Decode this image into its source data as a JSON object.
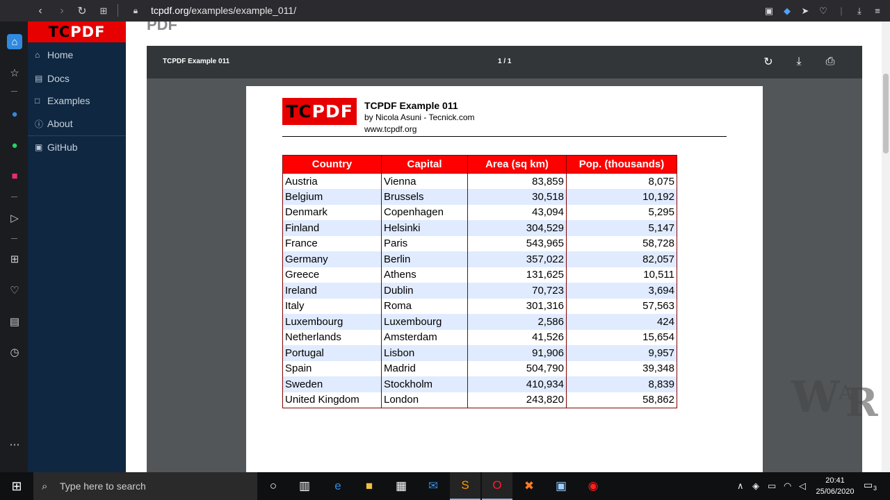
{
  "browser": {
    "url_host": "tcpdf.org",
    "url_path": "/examples/example_011/",
    "nav_icons": [
      "back-icon",
      "forward-icon",
      "reload-icon",
      "tabs-grid-icon",
      "lock-icon"
    ],
    "right_icons": [
      "camera-icon",
      "shield-icon",
      "send-icon",
      "heart-icon",
      "menu-icon",
      "download-icon",
      "more-icon"
    ]
  },
  "opera_sidebar": {
    "icons": [
      "home-icon",
      "star-icon",
      "messenger-icon",
      "whatsapp-icon",
      "instagram-icon",
      "player-icon",
      "apps-icon",
      "heart-icon",
      "news-icon",
      "history-icon",
      "more-icon"
    ]
  },
  "site": {
    "logo": "TCPDF",
    "nav": [
      {
        "label": "Home",
        "icon": "home-icon"
      },
      {
        "label": "Docs",
        "icon": "doc-icon"
      },
      {
        "label": "Examples",
        "icon": "file-icon"
      },
      {
        "label": "About",
        "icon": "info-icon"
      },
      {
        "label": "GitHub",
        "icon": "github-icon"
      }
    ],
    "page_heading": "PDF"
  },
  "viewer": {
    "title": "TCPDF Example 011",
    "pages": "1 / 1",
    "buttons": [
      "rotate-icon",
      "download-icon",
      "print-icon"
    ]
  },
  "document": {
    "logo": "TCPDF",
    "title": "TCPDF Example 011",
    "byline": "by Nicola Asuni - Tecnick.com",
    "website": "www.tcpdf.org",
    "table": {
      "headers": [
        "Country",
        "Capital",
        "Area (sq km)",
        "Pop. (thousands)"
      ],
      "rows": [
        [
          "Austria",
          "Vienna",
          "83,859",
          "8,075"
        ],
        [
          "Belgium",
          "Brussels",
          "30,518",
          "10,192"
        ],
        [
          "Denmark",
          "Copenhagen",
          "43,094",
          "5,295"
        ],
        [
          "Finland",
          "Helsinki",
          "304,529",
          "5,147"
        ],
        [
          "France",
          "Paris",
          "543,965",
          "58,728"
        ],
        [
          "Germany",
          "Berlin",
          "357,022",
          "82,057"
        ],
        [
          "Greece",
          "Athens",
          "131,625",
          "10,511"
        ],
        [
          "Ireland",
          "Dublin",
          "70,723",
          "3,694"
        ],
        [
          "Italy",
          "Roma",
          "301,316",
          "57,563"
        ],
        [
          "Luxembourg",
          "Luxembourg",
          "2,586",
          "424"
        ],
        [
          "Netherlands",
          "Amsterdam",
          "41,526",
          "15,654"
        ],
        [
          "Portugal",
          "Lisbon",
          "91,906",
          "9,957"
        ],
        [
          "Spain",
          "Madrid",
          "504,790",
          "39,348"
        ],
        [
          "Sweden",
          "Stockholm",
          "410,934",
          "8,839"
        ],
        [
          "United Kingdom",
          "London",
          "243,820",
          "58,862"
        ]
      ]
    }
  },
  "watermark": {
    "text": "WAR"
  },
  "taskbar": {
    "search_placeholder": "Type here to search",
    "apps": [
      "cortana-icon",
      "task-view-icon",
      "edge-icon",
      "file-explorer-icon",
      "store-icon",
      "mail-icon",
      "sublime-icon",
      "opera-icon",
      "xampp-icon",
      "network-app-icon",
      "recorder-icon"
    ],
    "time": "20:41",
    "date": "25/06/2020",
    "notifications": "3"
  },
  "colors": {
    "header_red": "#ff0000",
    "row_alt": "#e0ebff",
    "border": "#800000",
    "site_sidebar": "#0f2740"
  }
}
